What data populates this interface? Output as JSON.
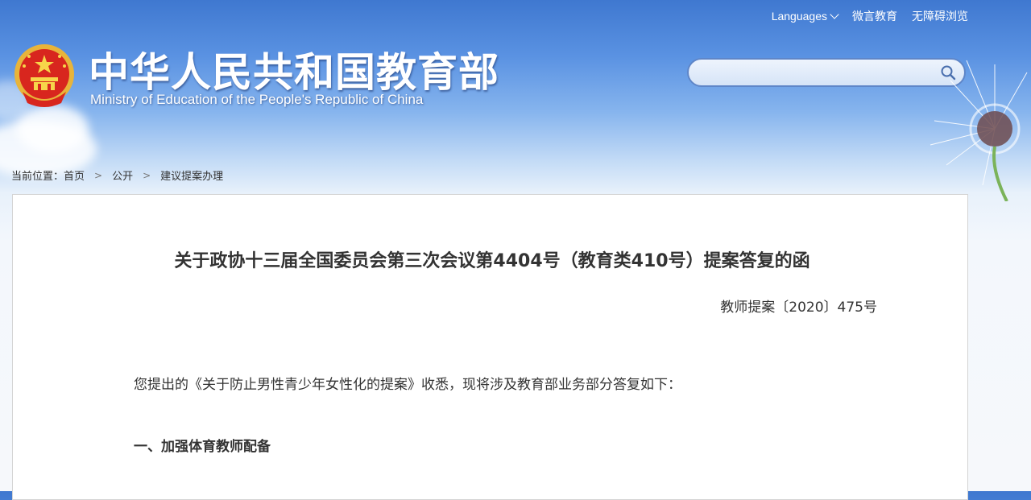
{
  "header": {
    "top_links": [
      "Languages",
      "微言教育",
      "无障碍浏览"
    ],
    "title_cn": "中华人民共和国教育部",
    "title_en": "Ministry of Education of the People's Republic of China",
    "search": {
      "placeholder": "",
      "value": ""
    }
  },
  "breadcrumb": {
    "prefix": "当前位置：",
    "items": [
      "首页",
      "公开",
      "建议提案办理"
    ],
    "separator": ">"
  },
  "document": {
    "title": "关于政协十三届全国委员会第三次会议第4404号（教育类410号）提案答复的函",
    "number": "教师提案〔2020〕475号",
    "intro": "您提出的《关于防止男性青少年女性化的提案》收悉，现将涉及教育部业务部分答复如下：",
    "section_1": "一、加强体育教师配备"
  },
  "colors": {
    "header_blue": "#3f78d0",
    "text": "#333333",
    "search_border": "#5f86c8"
  }
}
